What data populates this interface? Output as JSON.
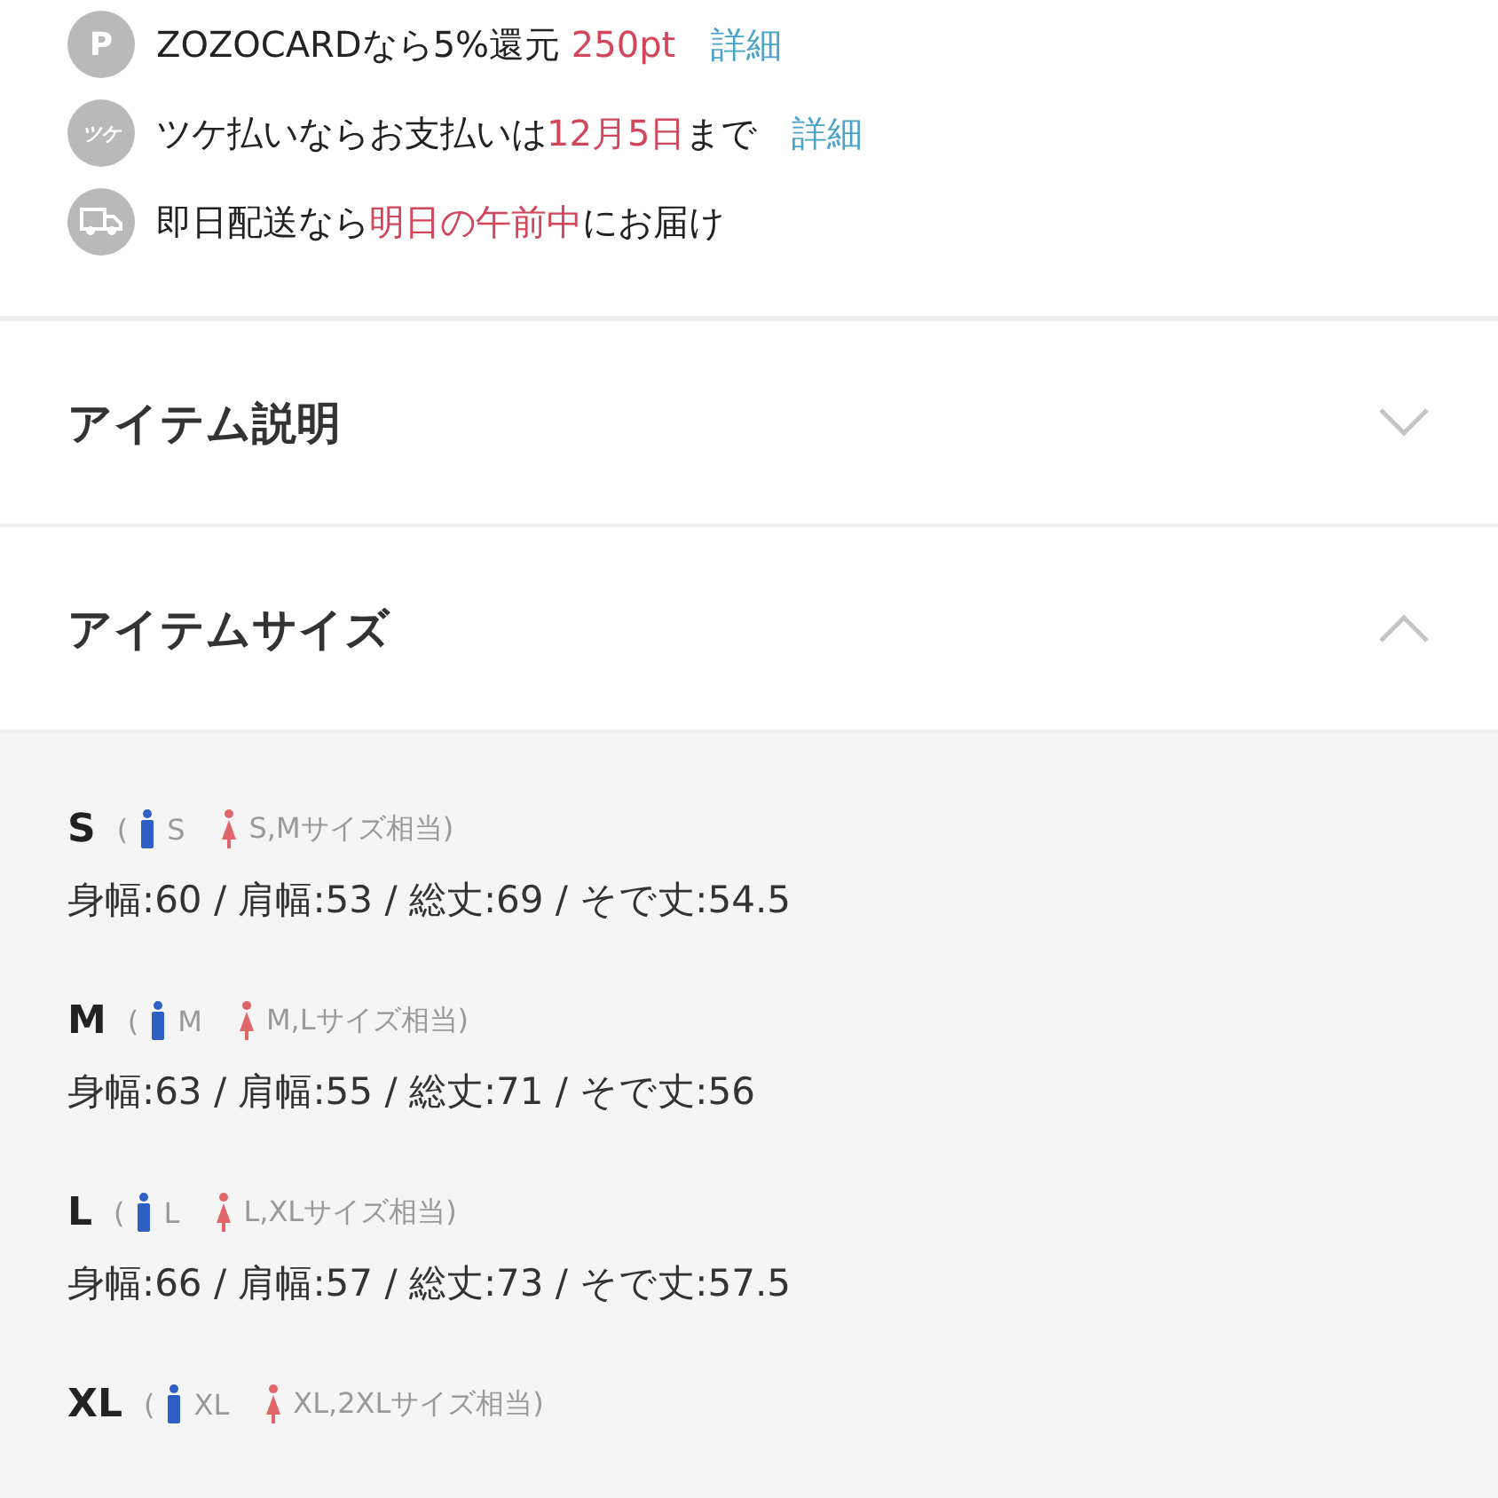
{
  "benefits": [
    {
      "icon": {
        "kind": "letter",
        "text": "P"
      },
      "parts": [
        {
          "text": "ZOZOCARDなら5%還元 ",
          "kind": "plain"
        },
        {
          "text": "250pt",
          "kind": "accent"
        }
      ],
      "link": "詳細"
    },
    {
      "icon": {
        "kind": "letter",
        "text": "ツケ"
      },
      "parts": [
        {
          "text": "ツケ払いならお支払いは",
          "kind": "plain"
        },
        {
          "text": "12月5日",
          "kind": "accent"
        },
        {
          "text": "まで",
          "kind": "plain"
        }
      ],
      "link": "詳細"
    },
    {
      "icon": {
        "kind": "truck"
      },
      "parts": [
        {
          "text": "即日配送なら",
          "kind": "plain"
        },
        {
          "text": "明日の午前中",
          "kind": "accent"
        },
        {
          "text": "にお届け",
          "kind": "plain"
        }
      ]
    }
  ],
  "sections": [
    {
      "title": "アイテム説明",
      "expanded": false
    },
    {
      "title": "アイテムサイズ",
      "expanded": true
    }
  ],
  "sizes": [
    {
      "label": "S",
      "paren": "(",
      "men": "S",
      "women": "S,Mサイズ相当)",
      "measurements": "身幅:60 / 肩幅:53 / 総丈:69 / そで丈:54.5"
    },
    {
      "label": "M",
      "paren": "(",
      "men": "M",
      "women": "M,Lサイズ相当)",
      "measurements": "身幅:63 / 肩幅:55 / 総丈:71 / そで丈:56"
    },
    {
      "label": "L",
      "paren": "(",
      "men": "L",
      "women": "L,XLサイズ相当)",
      "measurements": "身幅:66 / 肩幅:57 / 総丈:73 / そで丈:57.5"
    },
    {
      "label": "XL",
      "paren": "(",
      "men": "XL",
      "women": "XL,2XLサイズ相当)"
    }
  ]
}
